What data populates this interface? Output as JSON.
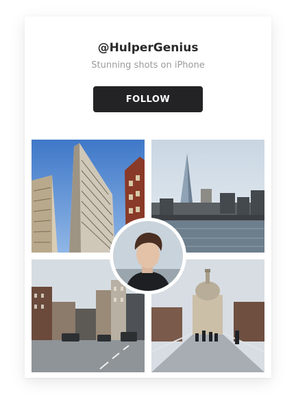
{
  "profile": {
    "handle": "@HulperGenius",
    "tagline": "Stunning shots on iPhone"
  },
  "actions": {
    "follow_label": "FOLLOW"
  },
  "gallery": {
    "photos": [
      {
        "subject": "flatiron-building"
      },
      {
        "subject": "the-shard-skyline"
      },
      {
        "subject": "city-street"
      },
      {
        "subject": "st-pauls-bridge"
      }
    ],
    "avatar": {
      "subject": "profile-portrait"
    }
  },
  "colors": {
    "button_bg": "#232326",
    "handle_text": "#2a2a2a",
    "tagline_text": "#9a9a9a"
  }
}
